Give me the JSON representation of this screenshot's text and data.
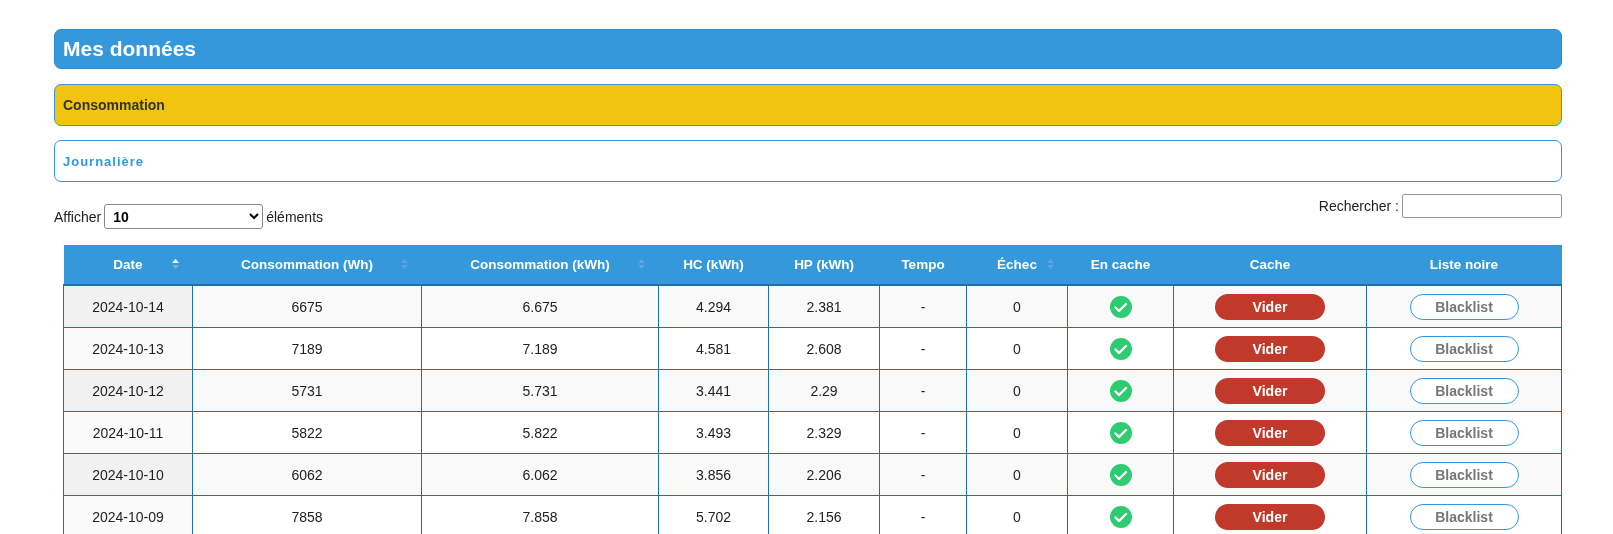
{
  "page_title": "Mes données",
  "section": {
    "title": "Consommation"
  },
  "subsection": {
    "title": "Journalière"
  },
  "length_control": {
    "label_before": "Afficher",
    "value": "10",
    "label_after": "éléments"
  },
  "search": {
    "label": "Rechercher :"
  },
  "table": {
    "columns": [
      {
        "label": "Date",
        "sortable": true,
        "sorted": true
      },
      {
        "label": "Consommation (Wh)",
        "sortable": true,
        "sorted": false
      },
      {
        "label": "Consommation (kWh)",
        "sortable": true,
        "sorted": false
      },
      {
        "label": "HC (kWh)",
        "sortable": false,
        "sorted": false
      },
      {
        "label": "HP (kWh)",
        "sortable": false,
        "sorted": false
      },
      {
        "label": "Tempo",
        "sortable": false,
        "sorted": false
      },
      {
        "label": "Échec",
        "sortable": true,
        "sorted": false
      },
      {
        "label": "En cache",
        "sortable": false,
        "sorted": false
      },
      {
        "label": "Cache",
        "sortable": false,
        "sorted": false
      },
      {
        "label": "Liste noire",
        "sortable": false,
        "sorted": false
      }
    ],
    "rows": [
      {
        "date": "2024-10-14",
        "wh": "6675",
        "kwh": "6.675",
        "hc": "4.294",
        "hp": "2.381",
        "tempo": "-",
        "echec": "0",
        "cached": true,
        "clear_button": "Vider",
        "blacklist_button": "Blacklist"
      },
      {
        "date": "2024-10-13",
        "wh": "7189",
        "kwh": "7.189",
        "hc": "4.581",
        "hp": "2.608",
        "tempo": "-",
        "echec": "0",
        "cached": true,
        "clear_button": "Vider",
        "blacklist_button": "Blacklist"
      },
      {
        "date": "2024-10-12",
        "wh": "5731",
        "kwh": "5.731",
        "hc": "3.441",
        "hp": "2.29",
        "tempo": "-",
        "echec": "0",
        "cached": true,
        "clear_button": "Vider",
        "blacklist_button": "Blacklist"
      },
      {
        "date": "2024-10-11",
        "wh": "5822",
        "kwh": "5.822",
        "hc": "3.493",
        "hp": "2.329",
        "tempo": "-",
        "echec": "0",
        "cached": true,
        "clear_button": "Vider",
        "blacklist_button": "Blacklist"
      },
      {
        "date": "2024-10-10",
        "wh": "6062",
        "kwh": "6.062",
        "hc": "3.856",
        "hp": "2.206",
        "tempo": "-",
        "echec": "0",
        "cached": true,
        "clear_button": "Vider",
        "blacklist_button": "Blacklist"
      },
      {
        "date": "2024-10-09",
        "wh": "7858",
        "kwh": "7.858",
        "hc": "5.702",
        "hp": "2.156",
        "tempo": "-",
        "echec": "0",
        "cached": true,
        "clear_button": "Vider",
        "blacklist_button": "Blacklist"
      }
    ]
  }
}
